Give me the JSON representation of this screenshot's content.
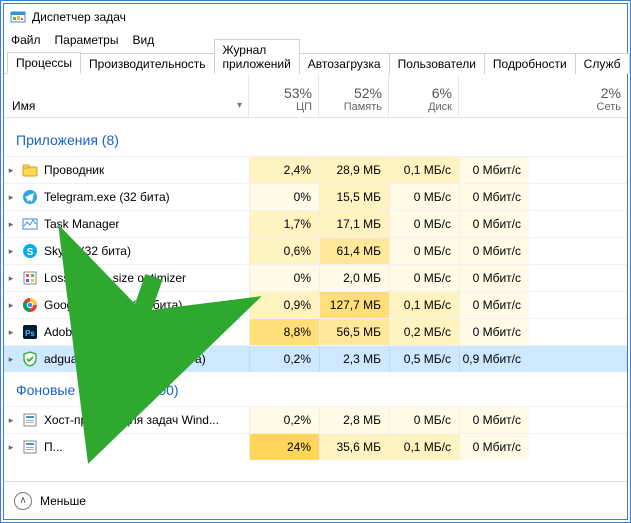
{
  "window": {
    "title": "Диспетчер задач"
  },
  "menu": {
    "file": "Файл",
    "options": "Параметры",
    "view": "Вид"
  },
  "tabs": {
    "processes": "Процессы",
    "performance": "Производительность",
    "app_history": "Журнал приложений",
    "startup": "Автозагрузка",
    "users": "Пользователи",
    "details": "Подробности",
    "services": "Служб"
  },
  "columns": {
    "name": "Имя",
    "cpu_pct": "53%",
    "cpu_lbl": "ЦП",
    "mem_pct": "52%",
    "mem_lbl": "Память",
    "disk_pct": "6%",
    "disk_lbl": "Диск",
    "net_pct": "2%",
    "net_lbl": "Сеть"
  },
  "groups": {
    "apps": "Приложения (8)",
    "bg": "Фоновые процессы (100)"
  },
  "rows": [
    {
      "name": "Проводник",
      "cpu": "2,4%",
      "mem": "28,9 МБ",
      "disk": "0,1 МБ/с",
      "net": "0 Мбит/с",
      "heat": [
        "h1",
        "h1",
        "h1",
        "h0"
      ],
      "icon": "explorer"
    },
    {
      "name": "Telegram.exe (32 бита)",
      "cpu": "0%",
      "mem": "15,5 МБ",
      "disk": "0 МБ/с",
      "net": "0 Мбит/с",
      "heat": [
        "h0",
        "h1",
        "h0",
        "h0"
      ],
      "icon": "telegram"
    },
    {
      "name": "Task Manager",
      "cpu": "1,7%",
      "mem": "17,1 МБ",
      "disk": "0 МБ/с",
      "net": "0 Мбит/с",
      "heat": [
        "h1",
        "h1",
        "h0",
        "h0"
      ],
      "icon": "taskmgr"
    },
    {
      "name": "Skype (32 бита)",
      "cpu": "0,6%",
      "mem": "61,4 МБ",
      "disk": "0 МБ/с",
      "net": "0 Мбит/с",
      "heat": [
        "h1",
        "h2",
        "h0",
        "h0"
      ],
      "icon": "skype"
    },
    {
      "name": "Lossless file size optimizer",
      "cpu": "0%",
      "mem": "2,0 МБ",
      "disk": "0 МБ/с",
      "net": "0 Мбит/с",
      "heat": [
        "h0",
        "h0",
        "h0",
        "h0"
      ],
      "icon": "lossless"
    },
    {
      "name": "Google Chrome (32 бита)",
      "cpu": "0,9%",
      "mem": "127,7 МБ",
      "disk": "0,1 МБ/с",
      "net": "0 Мбит/с",
      "heat": [
        "h1",
        "h3",
        "h1",
        "h0"
      ],
      "icon": "chrome"
    },
    {
      "name": "Adobe Photoshop CC 2015",
      "cpu": "8,8%",
      "mem": "56,5 МБ",
      "disk": "0,2 МБ/с",
      "net": "0 Мбит/с",
      "heat": [
        "h3",
        "h2",
        "h1",
        "h0"
      ],
      "icon": "photoshop"
    },
    {
      "name": "adguardInstaller.exe (32 бита)",
      "cpu": "0,2%",
      "mem": "2,3 МБ",
      "disk": "0,5 МБ/с",
      "net": "0,9 Мбит/с",
      "heat": [
        "h0",
        "h0",
        "h0",
        "h0"
      ],
      "icon": "adguard",
      "selected": true
    }
  ],
  "bg_rows": [
    {
      "name": "Хост-процесс для задач Wind...",
      "cpu": "0,2%",
      "mem": "2,8 МБ",
      "disk": "0 МБ/с",
      "net": "0 Мбит/с",
      "heat": [
        "h0",
        "h0",
        "h0",
        "h0"
      ],
      "icon": "generic"
    },
    {
      "name": "П...",
      "cpu": "24%",
      "mem": "35,6 МБ",
      "disk": "0,1 МБ/с",
      "net": "0 Мбит/с",
      "heat": [
        "h4",
        "h1",
        "h1",
        "h0"
      ],
      "icon": "generic"
    }
  ],
  "footer": {
    "fewer": "Меньше"
  },
  "colors": {
    "link": "#1663c7",
    "arrow": "#2fa82f"
  }
}
